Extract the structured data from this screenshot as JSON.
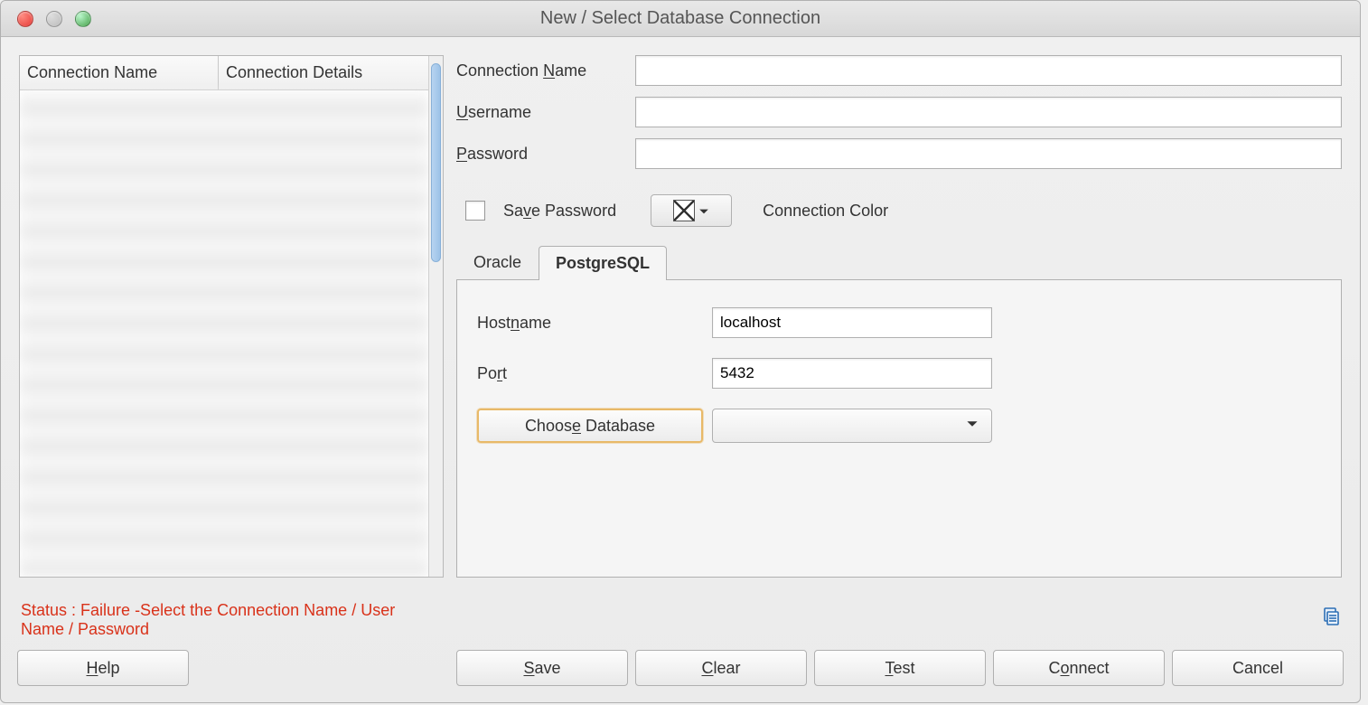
{
  "window": {
    "title": "New / Select Database Connection"
  },
  "leftPane": {
    "columns": [
      "Connection Name",
      "Connection Details"
    ]
  },
  "form": {
    "connectionName": {
      "label_pre": "Connection ",
      "label_u": "N",
      "label_post": "ame",
      "value": ""
    },
    "username": {
      "label_u": "U",
      "label_post": "sername",
      "value": ""
    },
    "password": {
      "label_u": "P",
      "label_post": "assword",
      "value": ""
    },
    "savePassword": {
      "label_pre": "Sa",
      "label_u": "v",
      "label_post": "e Password",
      "checked": false
    },
    "connectionColor": {
      "label": "Connection Color"
    }
  },
  "tabs": [
    {
      "id": "oracle",
      "label": "Oracle",
      "active": false
    },
    {
      "id": "postgres",
      "label": "PostgreSQL",
      "active": true
    }
  ],
  "postgresPanel": {
    "hostname": {
      "label_pre": "Host",
      "label_u": "n",
      "label_post": "ame",
      "value": "localhost"
    },
    "port": {
      "label_pre": "Po",
      "label_u": "r",
      "label_post": "t",
      "value": "5432"
    },
    "chooseDb": {
      "label_pre": "Choos",
      "label_u": "e",
      "label_post": " Database"
    },
    "dbSelected": ""
  },
  "status": {
    "prefix": "Status : ",
    "message": "Failure -Select the Connection Name / User Name / Password"
  },
  "buttons": {
    "help": {
      "u": "H",
      "post": "elp"
    },
    "save": {
      "u": "S",
      "post": "ave"
    },
    "clear": {
      "u": "C",
      "post": "lear"
    },
    "test": {
      "u": "T",
      "post": "est"
    },
    "connect": {
      "pre": "C",
      "u": "o",
      "post": "nnect"
    },
    "cancel": {
      "label": "Cancel"
    }
  }
}
